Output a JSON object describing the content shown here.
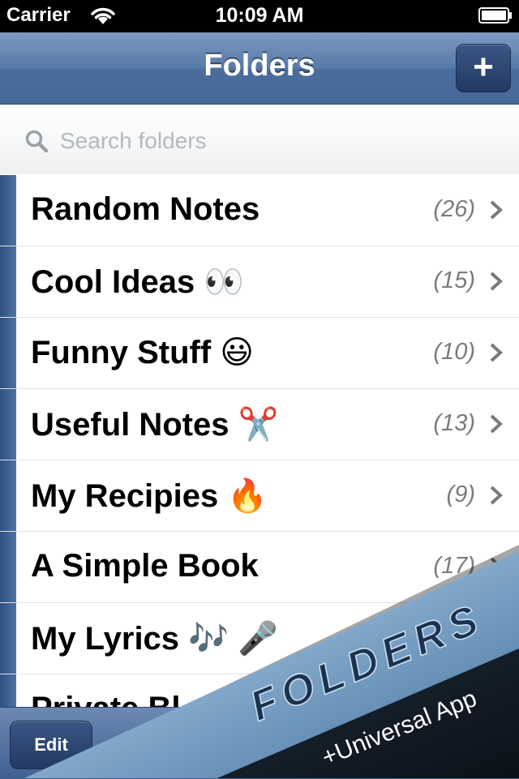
{
  "status_bar": {
    "carrier": "Carrier",
    "time": "10:09 AM",
    "wifi_icon": "wifi-icon",
    "battery_icon": "battery-icon"
  },
  "nav_bar": {
    "title": "Folders",
    "add_label": "+"
  },
  "search": {
    "placeholder": "Search folders"
  },
  "folders": [
    {
      "name": "Random Notes",
      "count": "(26)"
    },
    {
      "name": "Cool Ideas 👀",
      "count": "(15)"
    },
    {
      "name": "Funny Stuff 😃",
      "count": "(10)"
    },
    {
      "name": "Useful Notes ✂️",
      "count": "(13)"
    },
    {
      "name": "My Recipies 🔥",
      "count": "(9)"
    },
    {
      "name": "A Simple Book",
      "count": "(17)"
    },
    {
      "name": "My Lyrics 🎶 🎤",
      "count": ""
    },
    {
      "name": "Private Bl",
      "count": ""
    }
  ],
  "toolbar": {
    "edit_label": "Edit",
    "settings_icon": "gear-icon"
  },
  "promo": {
    "title": "FOLDERS",
    "subtitle": "+Universal App"
  },
  "colors": {
    "nav_blue": "#587aa8",
    "strip_blue": "#2f4f80",
    "count_gray": "#7b7b7b"
  }
}
